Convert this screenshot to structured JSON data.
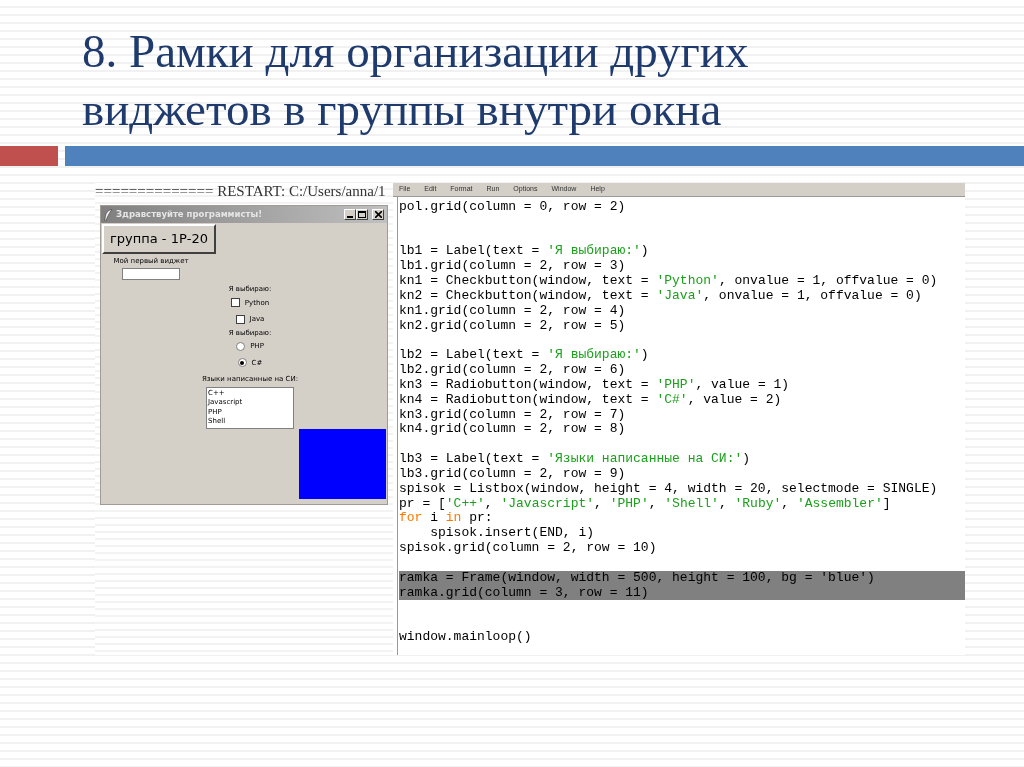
{
  "slide": {
    "title": "8. Рамки для организации других виджетов в группы внутри окна"
  },
  "shell": {
    "restart_line": "============== RESTART: C:/Users/anna/1"
  },
  "tk_window": {
    "title": "Здравствуйте программисты!",
    "button": "группа - 1Р-20",
    "entry_label": "Мой первый виджет",
    "check_label": "Я выбираю:",
    "checkbuttons": [
      {
        "label": "Python",
        "checked": false
      },
      {
        "label": "Java",
        "checked": false
      }
    ],
    "radio_label": "Я выбираю:",
    "radiobuttons": [
      {
        "label": "PHP",
        "selected": false
      },
      {
        "label": "C#",
        "selected": true
      }
    ],
    "listbox_label": "Языки написанные на СИ:",
    "listbox_items": [
      "C++",
      "Javascript",
      "PHP",
      "Shell"
    ]
  },
  "editor": {
    "menu": [
      "File",
      "Edit",
      "Format",
      "Run",
      "Options",
      "Window",
      "Help"
    ],
    "lines": [
      {
        "kind": "code",
        "selected": false,
        "parts": [
          {
            "t": "pol.grid(column = 0, row = 2)",
            "kind": "plain"
          }
        ]
      },
      {
        "kind": "blank"
      },
      {
        "kind": "blank"
      },
      {
        "kind": "code",
        "selected": false,
        "parts": [
          {
            "t": "lb1 = Label(text = ",
            "kind": "plain"
          },
          {
            "t": "'Я выбираю:'",
            "kind": "string"
          },
          {
            "t": ")",
            "kind": "plain"
          }
        ]
      },
      {
        "kind": "code",
        "selected": false,
        "parts": [
          {
            "t": "lb1.grid(column = 2, row = 3)",
            "kind": "plain"
          }
        ]
      },
      {
        "kind": "code",
        "selected": false,
        "parts": [
          {
            "t": "kn1 = Checkbutton(window, text = ",
            "kind": "plain"
          },
          {
            "t": "'Python'",
            "kind": "string"
          },
          {
            "t": ", onvalue = 1, offvalue = 0)",
            "kind": "plain"
          }
        ]
      },
      {
        "kind": "code",
        "selected": false,
        "parts": [
          {
            "t": "kn2 = Checkbutton(window, text = ",
            "kind": "plain"
          },
          {
            "t": "'Java'",
            "kind": "string"
          },
          {
            "t": ", onvalue = 1, offvalue = 0)",
            "kind": "plain"
          }
        ]
      },
      {
        "kind": "code",
        "selected": false,
        "parts": [
          {
            "t": "kn1.grid(column = 2, row = 4)",
            "kind": "plain"
          }
        ]
      },
      {
        "kind": "code",
        "selected": false,
        "parts": [
          {
            "t": "kn2.grid(column = 2, row = 5)",
            "kind": "plain"
          }
        ]
      },
      {
        "kind": "blank"
      },
      {
        "kind": "code",
        "selected": false,
        "parts": [
          {
            "t": "lb2 = Label(text = ",
            "kind": "plain"
          },
          {
            "t": "'Я выбираю:'",
            "kind": "string"
          },
          {
            "t": ")",
            "kind": "plain"
          }
        ]
      },
      {
        "kind": "code",
        "selected": false,
        "parts": [
          {
            "t": "lb2.grid(column = 2, row = 6)",
            "kind": "plain"
          }
        ]
      },
      {
        "kind": "code",
        "selected": false,
        "parts": [
          {
            "t": "kn3 = Radiobutton(window, text = ",
            "kind": "plain"
          },
          {
            "t": "'PHP'",
            "kind": "string"
          },
          {
            "t": ", value = 1)",
            "kind": "plain"
          }
        ]
      },
      {
        "kind": "code",
        "selected": false,
        "parts": [
          {
            "t": "kn4 = Radiobutton(window, text = ",
            "kind": "plain"
          },
          {
            "t": "'C#'",
            "kind": "string"
          },
          {
            "t": ", value = 2)",
            "kind": "plain"
          }
        ]
      },
      {
        "kind": "code",
        "selected": false,
        "parts": [
          {
            "t": "kn3.grid(column = 2, row = 7)",
            "kind": "plain"
          }
        ]
      },
      {
        "kind": "code",
        "selected": false,
        "parts": [
          {
            "t": "kn4.grid(column = 2, row = 8)",
            "kind": "plain"
          }
        ]
      },
      {
        "kind": "blank"
      },
      {
        "kind": "code",
        "selected": false,
        "parts": [
          {
            "t": "lb3 = Label(text = ",
            "kind": "plain"
          },
          {
            "t": "'Языки написанные на СИ:'",
            "kind": "string"
          },
          {
            "t": ")",
            "kind": "plain"
          }
        ]
      },
      {
        "kind": "code",
        "selected": false,
        "parts": [
          {
            "t": "lb3.grid(column = 2, row = 9)",
            "kind": "plain"
          }
        ]
      },
      {
        "kind": "code",
        "selected": false,
        "parts": [
          {
            "t": "spisok = Listbox(window, height = 4, width = 20, selectmode = SINGLE)",
            "kind": "plain"
          }
        ]
      },
      {
        "kind": "code",
        "selected": false,
        "parts": [
          {
            "t": "pr = [",
            "kind": "plain"
          },
          {
            "t": "'C++'",
            "kind": "string"
          },
          {
            "t": ", ",
            "kind": "plain"
          },
          {
            "t": "'Javascript'",
            "kind": "string"
          },
          {
            "t": ", ",
            "kind": "plain"
          },
          {
            "t": "'PHP'",
            "kind": "string"
          },
          {
            "t": ", ",
            "kind": "plain"
          },
          {
            "t": "'Shell'",
            "kind": "string"
          },
          {
            "t": ", ",
            "kind": "plain"
          },
          {
            "t": "'Ruby'",
            "kind": "string"
          },
          {
            "t": ", ",
            "kind": "plain"
          },
          {
            "t": "'Assembler'",
            "kind": "string"
          },
          {
            "t": "]",
            "kind": "plain"
          }
        ]
      },
      {
        "kind": "code",
        "selected": false,
        "parts": [
          {
            "t": "for",
            "kind": "keyword"
          },
          {
            "t": " i ",
            "kind": "plain"
          },
          {
            "t": "in",
            "kind": "keyword"
          },
          {
            "t": " pr:",
            "kind": "plain"
          }
        ]
      },
      {
        "kind": "code",
        "selected": false,
        "parts": [
          {
            "t": "    spisok.insert(END, i)",
            "kind": "plain"
          }
        ]
      },
      {
        "kind": "code",
        "selected": false,
        "parts": [
          {
            "t": "spisok.grid(column = 2, row = 10)",
            "kind": "plain"
          }
        ]
      },
      {
        "kind": "blank"
      },
      {
        "kind": "code",
        "selected": true,
        "parts": [
          {
            "t": "ramka = Frame(window, width = 500, height = 100, bg = 'blue')",
            "kind": "plain"
          }
        ]
      },
      {
        "kind": "code",
        "selected": true,
        "parts": [
          {
            "t": "ramka.grid(column = 3, row = 11)",
            "kind": "plain"
          }
        ]
      },
      {
        "kind": "blank"
      },
      {
        "kind": "blank"
      },
      {
        "kind": "code",
        "selected": false,
        "parts": [
          {
            "t": "window.mainloop()",
            "kind": "plain"
          }
        ]
      }
    ]
  }
}
